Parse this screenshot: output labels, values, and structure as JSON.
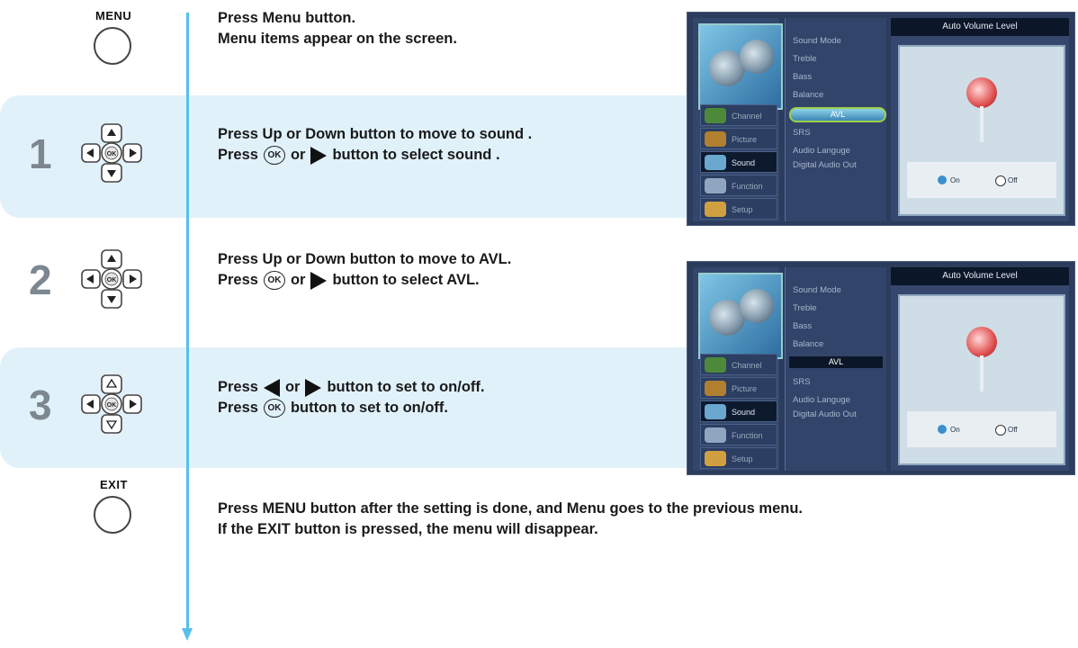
{
  "buttons": {
    "menu_label": "MENU",
    "exit_label": "EXIT",
    "ok_label": "OK"
  },
  "steps": {
    "menu": {
      "line1": "Press Menu button.",
      "line2": "Menu items appear on the screen."
    },
    "step1": {
      "number": "1",
      "line1": "Press Up or Down button to move to sound .",
      "line2_pre": "Press",
      "line2_mid": "or",
      "line2_post": "button  to select sound ."
    },
    "step2": {
      "number": "2",
      "line1": "Press Up or Down button to move to AVL.",
      "line2_pre": "Press",
      "line2_mid": "or",
      "line2_post": "button  to select AVL."
    },
    "step3": {
      "number": "3",
      "line1_pre": "Press",
      "line1_mid": "or",
      "line1_post": "button to set to on/off.",
      "line2_pre": "Press",
      "line2_post": "button  to set to on/off."
    },
    "exit": {
      "line1": "Press MENU button after the setting is done, and Menu goes to the previous menu.",
      "line2": "If the EXIT button is pressed, the menu will disappear."
    }
  },
  "tv_menu": {
    "sidebar": [
      "Channel",
      "Picture",
      "Sound",
      "Function",
      "Setup"
    ],
    "items": [
      "Sound Mode",
      "Treble",
      "Bass",
      "Balance",
      "AVL",
      "SRS",
      "Audio Languge",
      "Digital Audio Out"
    ],
    "panel_title": "Auto Volume Level",
    "on_label": "On",
    "off_label": "Off"
  },
  "colors": {
    "band": "#e1f1fa",
    "timeline": "#56c0ea",
    "step_number": "#7d8790"
  }
}
